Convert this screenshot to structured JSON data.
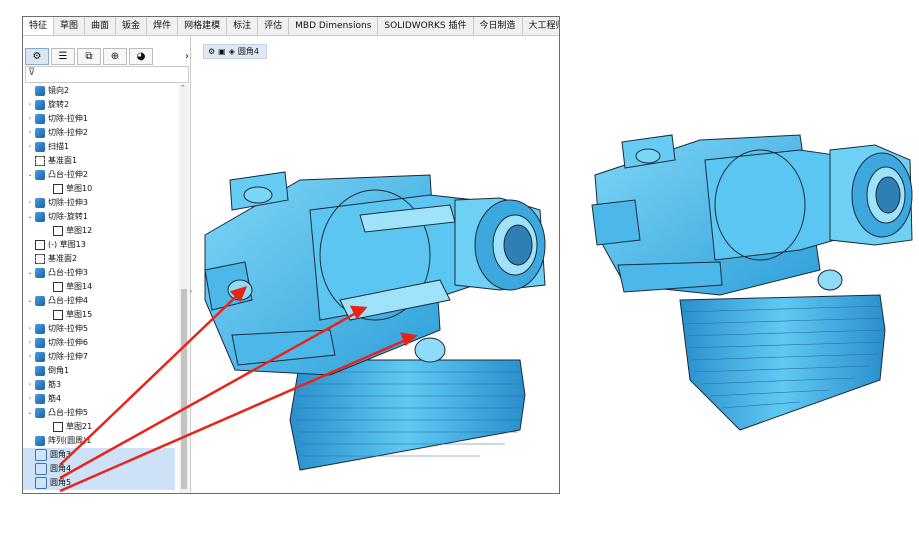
{
  "tabs": [
    "特征",
    "草图",
    "曲面",
    "钣金",
    "焊件",
    "网格建模",
    "标注",
    "评估",
    "MBD Dimensions",
    "SOLIDWORKS 插件",
    "今日制造",
    "大工程师"
  ],
  "panel_tools": [
    "feature-manager-icon",
    "property-manager-icon",
    "configuration-manager-icon",
    "dimxpert-icon",
    "display-manager-icon"
  ],
  "panel_next": "›",
  "breadcrumb": {
    "label": "圆角4"
  },
  "tree": [
    {
      "label": "镜向2",
      "icon": "feat",
      "expand": ""
    },
    {
      "label": "旋转2",
      "icon": "feat",
      "expand": "›"
    },
    {
      "label": "切除-拉伸1",
      "icon": "feat",
      "expand": "›"
    },
    {
      "label": "切除-拉伸2",
      "icon": "feat",
      "expand": "›"
    },
    {
      "label": "扫描1",
      "icon": "feat",
      "expand": "›"
    },
    {
      "label": "基准面1",
      "icon": "plane",
      "expand": ""
    },
    {
      "label": "凸台-拉伸2",
      "icon": "feat",
      "expand": "⌄"
    },
    {
      "label": "草图10",
      "icon": "sketch",
      "expand": "",
      "indent": 1
    },
    {
      "label": "切除-拉伸3",
      "icon": "feat",
      "expand": "›"
    },
    {
      "label": "切除-旋转1",
      "icon": "feat",
      "expand": "⌄"
    },
    {
      "label": "草图12",
      "icon": "sketch",
      "expand": "",
      "indent": 1
    },
    {
      "label": "(-) 草图13",
      "icon": "sketch",
      "expand": ""
    },
    {
      "label": "基准面2",
      "icon": "plane",
      "expand": ""
    },
    {
      "label": "凸台-拉伸3",
      "icon": "feat",
      "expand": "⌄"
    },
    {
      "label": "草图14",
      "icon": "sketch",
      "expand": "",
      "indent": 1
    },
    {
      "label": "凸台-拉伸4",
      "icon": "feat",
      "expand": "⌄"
    },
    {
      "label": "草图15",
      "icon": "sketch",
      "expand": "",
      "indent": 1
    },
    {
      "label": "切除-拉伸5",
      "icon": "feat",
      "expand": "›"
    },
    {
      "label": "切除-拉伸6",
      "icon": "feat",
      "expand": "›"
    },
    {
      "label": "切除-拉伸7",
      "icon": "feat",
      "expand": "›"
    },
    {
      "label": "倒角1",
      "icon": "feat",
      "expand": ""
    },
    {
      "label": "筋3",
      "icon": "feat",
      "expand": "›"
    },
    {
      "label": "筋4",
      "icon": "feat",
      "expand": "›"
    },
    {
      "label": "凸台-拉伸5",
      "icon": "feat",
      "expand": "⌄"
    },
    {
      "label": "草图21",
      "icon": "sketch",
      "expand": "",
      "indent": 1
    },
    {
      "label": "阵列(圆周)1",
      "icon": "feat",
      "expand": ""
    },
    {
      "label": "圆角3",
      "icon": "fillet",
      "expand": "",
      "selected": true
    },
    {
      "label": "圆角4",
      "icon": "fillet",
      "expand": "",
      "selected": true
    },
    {
      "label": "圆角5",
      "icon": "fillet",
      "expand": "",
      "selected": true
    }
  ],
  "colors": {
    "model": "#4fc3f2",
    "model_dark": "#1e86c4",
    "edge": "#1b2a3a",
    "arrow": "#e8241a",
    "selection": "#cde1f7"
  }
}
